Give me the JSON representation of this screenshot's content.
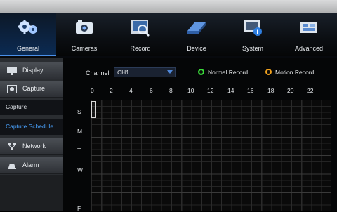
{
  "nav": {
    "items": [
      {
        "label": "General",
        "icon": "gears-icon",
        "active": true
      },
      {
        "label": "Cameras",
        "icon": "camera-icon",
        "active": false
      },
      {
        "label": "Record",
        "icon": "record-search-icon",
        "active": false
      },
      {
        "label": "Device",
        "icon": "hard-drive-icon",
        "active": false
      },
      {
        "label": "System",
        "icon": "system-info-icon",
        "active": false
      },
      {
        "label": "Advanced",
        "icon": "advanced-icon",
        "active": false
      }
    ]
  },
  "sidebar": {
    "items": [
      {
        "label": "Display",
        "icon": "display-icon"
      },
      {
        "label": "Capture",
        "icon": "capture-icon"
      }
    ],
    "sub_items": [
      {
        "label": "Capture",
        "active": false
      },
      {
        "label": "Capture Schedule",
        "active": true
      }
    ],
    "items_after": [
      {
        "label": "Network",
        "icon": "network-icon"
      },
      {
        "label": "Alarm",
        "icon": "alarm-icon"
      }
    ]
  },
  "schedule": {
    "channel_label": "Channel",
    "channel_value": "CH1",
    "legend_normal": "Normal Record",
    "legend_motion": "Motion Record",
    "hours": [
      "0",
      "2",
      "4",
      "6",
      "8",
      "10",
      "12",
      "14",
      "16",
      "18",
      "20",
      "22"
    ],
    "days": [
      "S",
      "M",
      "T",
      "W",
      "T",
      "F"
    ]
  },
  "colors": {
    "accent": "#4aa3ff",
    "normal_record": "#3adb3a",
    "motion_record": "#f0a11e"
  }
}
